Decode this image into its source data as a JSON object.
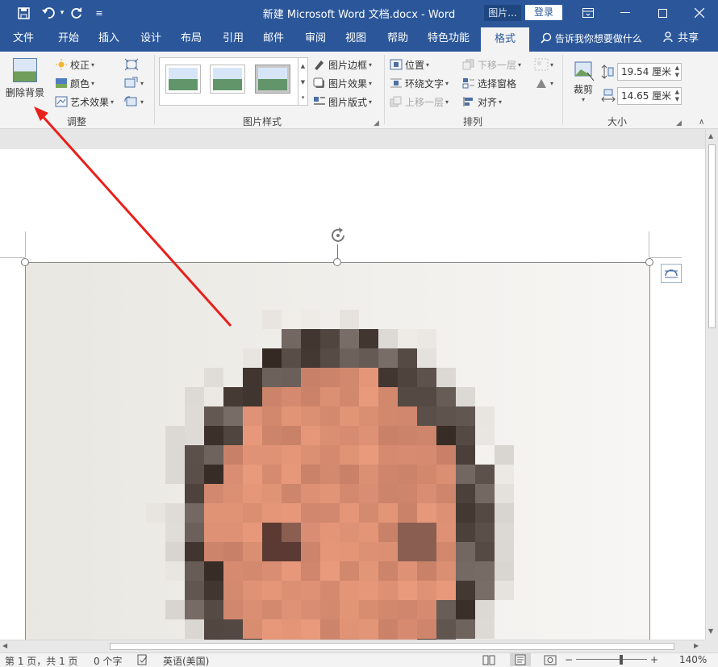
{
  "titlebar": {
    "title": "新建 Microsoft Word 文档.docx  -  Word",
    "context_tab": "图片...",
    "login": "登录",
    "save_icon": "save-icon",
    "undo_icon": "undo-icon",
    "redo_icon": "redo-icon"
  },
  "tabs": [
    "文件",
    "开始",
    "插入",
    "设计",
    "布局",
    "引用",
    "邮件",
    "审阅",
    "视图",
    "帮助",
    "特色功能",
    "格式"
  ],
  "active_tab": "格式",
  "tellme": "告诉我你想要做什么",
  "share": "共享",
  "ribbon": {
    "adjust": {
      "remove_bg": "删除背景",
      "corrections": "校正",
      "color": "颜色",
      "artistic": "艺术效果",
      "label": "调整"
    },
    "styles": {
      "border": "图片边框",
      "effects": "图片效果",
      "layout": "图片版式",
      "label": "图片样式"
    },
    "arrange": {
      "position": "位置",
      "wrap": "环绕文字",
      "forward": "上移一层",
      "backward": "下移一层",
      "selection_pane": "选择窗格",
      "align": "对齐",
      "label": "排列"
    },
    "size": {
      "crop": "裁剪",
      "height": "19.54 厘米",
      "width": "14.65 厘米",
      "label": "大小"
    }
  },
  "status": {
    "page": "第 1 页，共 1 页",
    "words": "0 个字",
    "lang": "英语(美国)",
    "zoom": "140%"
  },
  "colors": {
    "accent": "#2b579a",
    "arrow": "#e8201c"
  }
}
